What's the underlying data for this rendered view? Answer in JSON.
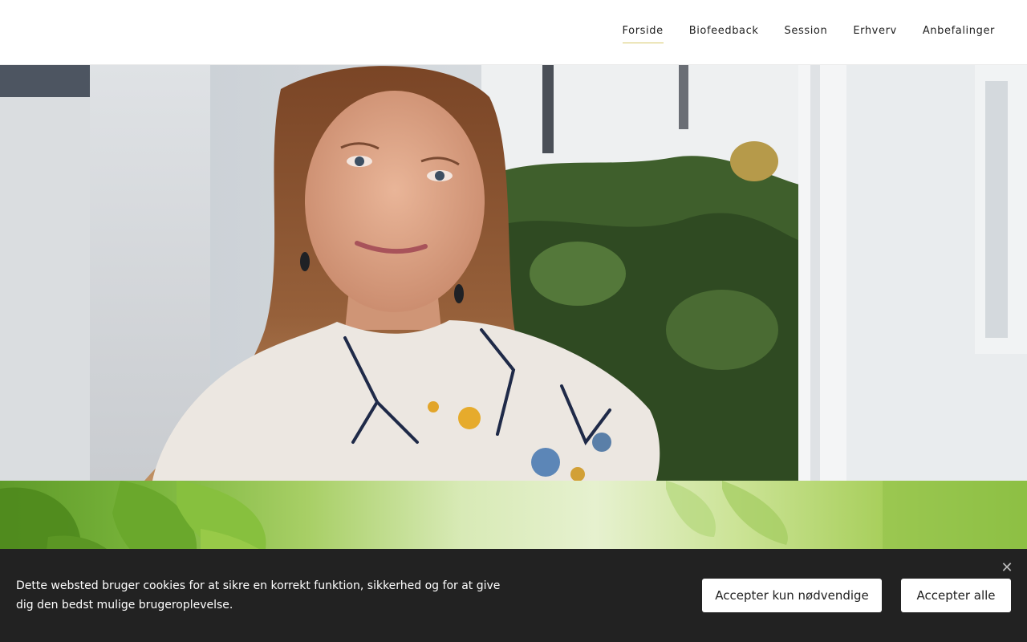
{
  "nav": {
    "items": [
      {
        "label": "Forside",
        "active": true
      },
      {
        "label": "Biofeedback",
        "active": false
      },
      {
        "label": "Session",
        "active": false
      },
      {
        "label": "Erhverv",
        "active": false
      },
      {
        "label": "Anbefalinger",
        "active": false
      }
    ],
    "active_underline_color": "#d7c96a"
  },
  "hero": {
    "image": "portrait-photo",
    "colors": {
      "wall": "#e4e6e8",
      "hair": "#8a5634",
      "shirt": "#efeae4",
      "foliage": "#3c5a2a"
    }
  },
  "banner": {
    "image": "green-leaves-photo"
  },
  "cookie_banner": {
    "text": "Dette websted bruger cookies for at sikre en korrekt funktion, sikkerhed og for at give dig den bedst mulige brugeroplevelse.",
    "accept_necessary_label": "Accepter kun nødvendige",
    "accept_all_label": "Accepter alle",
    "close_icon": "close-icon",
    "background": "#222222"
  }
}
